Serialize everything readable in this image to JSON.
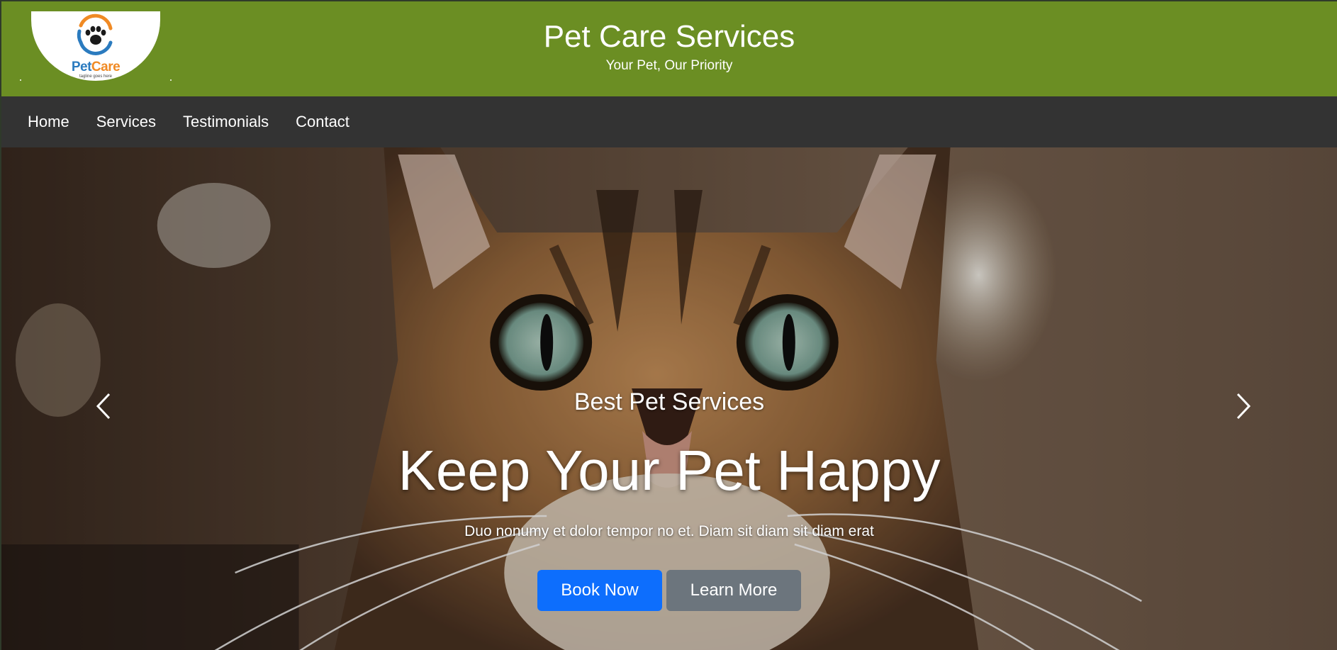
{
  "header": {
    "title": "Pet Care Services",
    "tagline": "Your Pet, Our Priority",
    "logo": {
      "brand_part1": "Pet",
      "brand_part2": "Care",
      "tagline": "tagline goes here",
      "icon": "paw-icon",
      "colors": {
        "blue": "#2b7bbf",
        "orange": "#f08a24"
      }
    },
    "background": "#6b8e23"
  },
  "nav": {
    "items": [
      {
        "label": "Home"
      },
      {
        "label": "Services"
      },
      {
        "label": "Testimonials"
      },
      {
        "label": "Contact"
      }
    ],
    "background": "#333333"
  },
  "hero": {
    "kicker": "Best Pet Services",
    "heading": "Keep Your Pet Happy",
    "description": "Duo nonumy et dolor tempor no et. Diam sit diam sit diam erat",
    "primary_button": "Book Now",
    "secondary_button": "Learn More",
    "prev_icon": "chevron-left-icon",
    "next_icon": "chevron-right-icon",
    "colors": {
      "primary": "#0d6efd",
      "secondary": "#6c757d"
    }
  }
}
